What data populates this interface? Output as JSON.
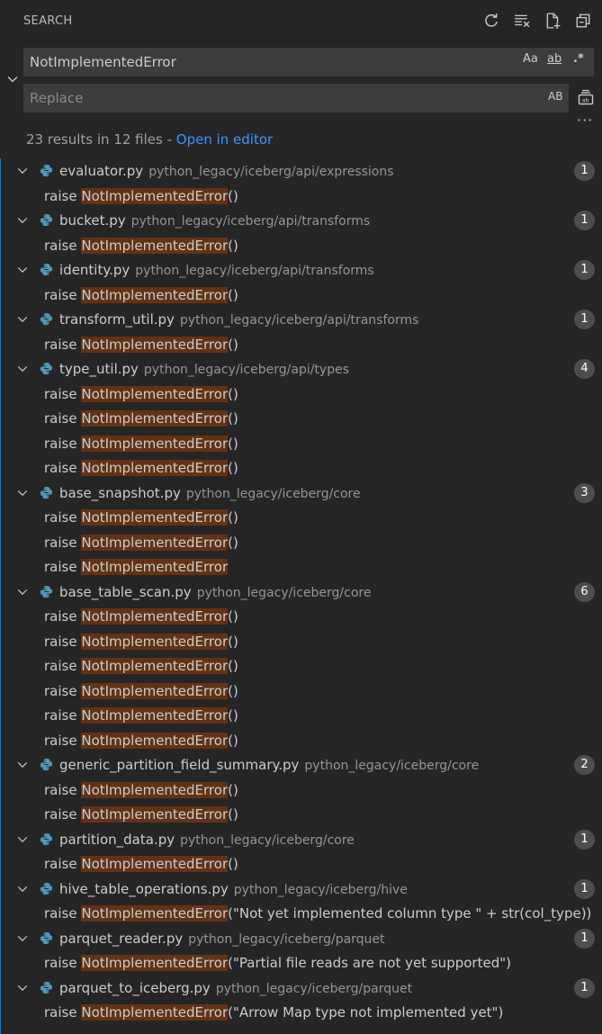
{
  "header": {
    "title": "SEARCH",
    "icons": [
      "refresh-icon",
      "clear-results-icon",
      "new-search-editor-icon",
      "collapse-all-icon"
    ]
  },
  "search": {
    "value": "NotImplementedError",
    "options": {
      "match_case": "Aa",
      "whole_word": "ab",
      "regex": ".*"
    }
  },
  "replace": {
    "placeholder": "Replace",
    "preserve_case": "AB"
  },
  "summary": {
    "text": "23 results in 12 files - ",
    "link": "Open in editor"
  },
  "files": [
    {
      "name": "evaluator.py",
      "path": "python_legacy/iceberg/api/expressions",
      "count": "1",
      "matches": [
        {
          "prefix": "raise ",
          "hit": "NotImplementedError",
          "suffix": "()"
        }
      ]
    },
    {
      "name": "bucket.py",
      "path": "python_legacy/iceberg/api/transforms",
      "count": "1",
      "matches": [
        {
          "prefix": "raise ",
          "hit": "NotImplementedError",
          "suffix": "()"
        }
      ]
    },
    {
      "name": "identity.py",
      "path": "python_legacy/iceberg/api/transforms",
      "count": "1",
      "matches": [
        {
          "prefix": "raise ",
          "hit": "NotImplementedError",
          "suffix": "()"
        }
      ]
    },
    {
      "name": "transform_util.py",
      "path": "python_legacy/iceberg/api/transforms",
      "count": "1",
      "matches": [
        {
          "prefix": "raise ",
          "hit": "NotImplementedError",
          "suffix": "()"
        }
      ]
    },
    {
      "name": "type_util.py",
      "path": "python_legacy/iceberg/api/types",
      "count": "4",
      "matches": [
        {
          "prefix": "raise ",
          "hit": "NotImplementedError",
          "suffix": "()"
        },
        {
          "prefix": "raise ",
          "hit": "NotImplementedError",
          "suffix": "()"
        },
        {
          "prefix": "raise ",
          "hit": "NotImplementedError",
          "suffix": "()"
        },
        {
          "prefix": "raise ",
          "hit": "NotImplementedError",
          "suffix": "()"
        }
      ]
    },
    {
      "name": "base_snapshot.py",
      "path": "python_legacy/iceberg/core",
      "count": "3",
      "matches": [
        {
          "prefix": "raise ",
          "hit": "NotImplementedError",
          "suffix": "()"
        },
        {
          "prefix": "raise ",
          "hit": "NotImplementedError",
          "suffix": "()"
        },
        {
          "prefix": "raise ",
          "hit": "NotImplementedError",
          "suffix": ""
        }
      ]
    },
    {
      "name": "base_table_scan.py",
      "path": "python_legacy/iceberg/core",
      "count": "6",
      "matches": [
        {
          "prefix": "raise ",
          "hit": "NotImplementedError",
          "suffix": "()"
        },
        {
          "prefix": "raise ",
          "hit": "NotImplementedError",
          "suffix": "()"
        },
        {
          "prefix": "raise ",
          "hit": "NotImplementedError",
          "suffix": "()"
        },
        {
          "prefix": "raise ",
          "hit": "NotImplementedError",
          "suffix": "()"
        },
        {
          "prefix": "raise ",
          "hit": "NotImplementedError",
          "suffix": "()"
        },
        {
          "prefix": "raise ",
          "hit": "NotImplementedError",
          "suffix": "()"
        }
      ]
    },
    {
      "name": "generic_partition_field_summary.py",
      "path": "python_legacy/iceberg/core",
      "count": "2",
      "matches": [
        {
          "prefix": "raise ",
          "hit": "NotImplementedError",
          "suffix": "()"
        },
        {
          "prefix": "raise ",
          "hit": "NotImplementedError",
          "suffix": "()"
        }
      ]
    },
    {
      "name": "partition_data.py",
      "path": "python_legacy/iceberg/core",
      "count": "1",
      "matches": [
        {
          "prefix": "raise ",
          "hit": "NotImplementedError",
          "suffix": "()"
        }
      ]
    },
    {
      "name": "hive_table_operations.py",
      "path": "python_legacy/iceberg/hive",
      "count": "1",
      "matches": [
        {
          "prefix": "raise ",
          "hit": "NotImplementedError",
          "suffix": "(\"Not yet implemented column type \" + str(col_type))"
        }
      ]
    },
    {
      "name": "parquet_reader.py",
      "path": "python_legacy/iceberg/parquet",
      "count": "1",
      "matches": [
        {
          "prefix": "raise ",
          "hit": "NotImplementedError",
          "suffix": "(\"Partial file reads are not yet supported\")"
        }
      ]
    },
    {
      "name": "parquet_to_iceberg.py",
      "path": "python_legacy/iceberg/parquet",
      "count": "1",
      "matches": [
        {
          "prefix": "raise ",
          "hit": "NotImplementedError",
          "suffix": "(\"Arrow Map type not implemented yet\")"
        }
      ]
    }
  ],
  "colors": {
    "background": "#252526",
    "input_background": "#3c3c3c",
    "match_highlight": "#613214",
    "link": "#3794ff",
    "badge": "#4d4d4d",
    "focus_border": "#007fd4"
  }
}
